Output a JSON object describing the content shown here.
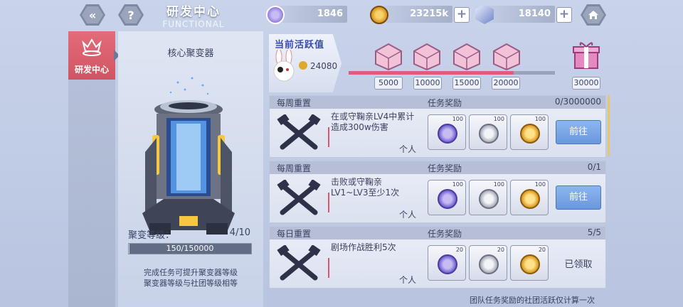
{
  "header": {
    "back_icon": "double-chevron-left-icon",
    "help_icon": "question-icon",
    "title": "研发中心",
    "subtitle": "FUNCTIONAL",
    "home_icon": "home-icon"
  },
  "resources": [
    {
      "name": "purple-token",
      "value": "1846",
      "color": "#8f7de0"
    },
    {
      "name": "gold-coin",
      "value": "23215k",
      "color": "#e7a52a"
    },
    {
      "name": "crystal",
      "value": "18140",
      "color": "#6f84c9"
    }
  ],
  "sidebar": {
    "active_tab": "研发中心",
    "accent": "#d65a68"
  },
  "left_panel": {
    "title": "核心聚变器",
    "level_label": "聚变等级：",
    "level_value": "4/10",
    "exp_text": "150/150000",
    "exp_progress": 0.001,
    "desc_line1": "完成任务可提升聚变器等级",
    "desc_line2": "聚变器等级与社团等级相等"
  },
  "activity": {
    "title": "当前活跃值",
    "value": "24080",
    "progress": 0.8,
    "milestones": [
      "5000",
      "10000",
      "15000",
      "20000",
      "30000"
    ]
  },
  "tasks": [
    {
      "type": "每周重置",
      "reward_label": "任务奖励",
      "progress": "0/3000000",
      "desc": "在或守鞠亲LV4中累计造成300w伤害",
      "scope": "个人",
      "rewards": [
        {
          "count": "100"
        },
        {
          "count": "100"
        },
        {
          "count": "100"
        }
      ],
      "action": "前往"
    },
    {
      "type": "每周重置",
      "reward_label": "任务奖励",
      "progress": "0/1",
      "desc": "击败或守鞠亲LV1~LV3至少1次",
      "scope": "个人",
      "rewards": [
        {
          "count": "100"
        },
        {
          "count": "100"
        },
        {
          "count": "100"
        }
      ],
      "action": "前往"
    },
    {
      "type": "每日重置",
      "reward_label": "任务奖励",
      "progress": "5/5",
      "desc": "剧场作战胜利5次",
      "scope": "个人",
      "rewards": [
        {
          "count": "20"
        },
        {
          "count": "20"
        },
        {
          "count": "20"
        }
      ],
      "status": "已领取"
    }
  ],
  "footer": "团队任务奖励的社团活跃仅计算一次"
}
